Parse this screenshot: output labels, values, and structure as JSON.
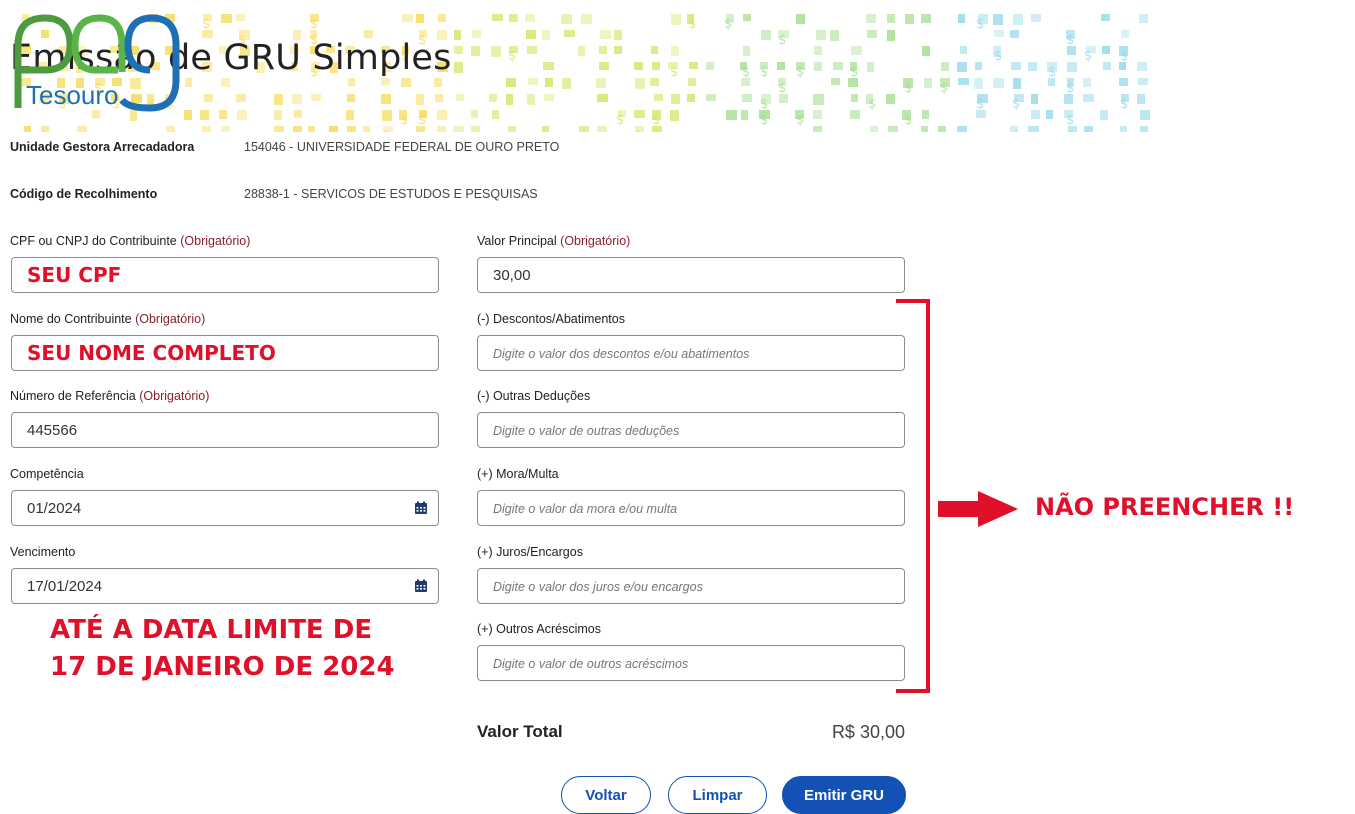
{
  "header": {
    "title": "Emissão de GRU Simples",
    "logo": {
      "text_top": "pag",
      "text_bottom": "Tesouro"
    }
  },
  "info": [
    {
      "label": "Unidade Gestora Arrecadadora",
      "value": "154046 - UNIVERSIDADE FEDERAL DE OURO PRETO"
    },
    {
      "label": "Código de Recolhimento",
      "value": "28838-1 - SERVICOS DE ESTUDOS E PESQUISAS"
    }
  ],
  "required_suffix": "(Obrigatório)",
  "left_fields": {
    "cpf": {
      "label": "CPF ou CNPJ do Contribuinte",
      "value": "SEU CPF"
    },
    "nome": {
      "label": "Nome do Contribuinte",
      "value": "SEU NOME COMPLETO"
    },
    "referencia": {
      "label": "Número de Referência",
      "value": "445566"
    },
    "competencia": {
      "label": "Competência",
      "value": "01/2024"
    },
    "vencimento": {
      "label": "Vencimento",
      "value": "17/01/2024"
    }
  },
  "right_fields": {
    "valor_principal": {
      "label": "Valor Principal",
      "value": "30,00"
    },
    "descontos": {
      "label": "(-) Descontos/Abatimentos",
      "placeholder": "Digite o valor dos descontos e/ou abatimentos"
    },
    "deducoes": {
      "label": "(-) Outras Deduções",
      "placeholder": "Digite o valor de outras deduções"
    },
    "mora": {
      "label": "(+) Mora/Multa",
      "placeholder": "Digite o valor da mora e/ou multa"
    },
    "juros": {
      "label": "(+) Juros/Encargos",
      "placeholder": "Digite o valor dos juros e/ou encargos"
    },
    "acrescimos": {
      "label": "(+) Outros Acréscimos",
      "placeholder": "Digite o valor de outros acréscimos"
    }
  },
  "annotations": {
    "deadline_line1": "ATÉ A DATA LIMITE DE",
    "deadline_line2": "17 DE JANEIRO DE 2024",
    "do_not_fill": "NÃO PREENCHER !!"
  },
  "total": {
    "label": "Valor Total",
    "value": "R$ 30,00"
  },
  "buttons": {
    "voltar": "Voltar",
    "limpar": "Limpar",
    "emitir": "Emitir GRU"
  },
  "colors": {
    "primary": "#1351b4",
    "required": "#8b1f2e",
    "annotation_red": "#e0102a",
    "logo_green": "#4e9a3f",
    "logo_blue": "#1f6fb5"
  },
  "icons": [
    "calendar-icon",
    "arrow-right-icon",
    "bracket-annotation"
  ]
}
